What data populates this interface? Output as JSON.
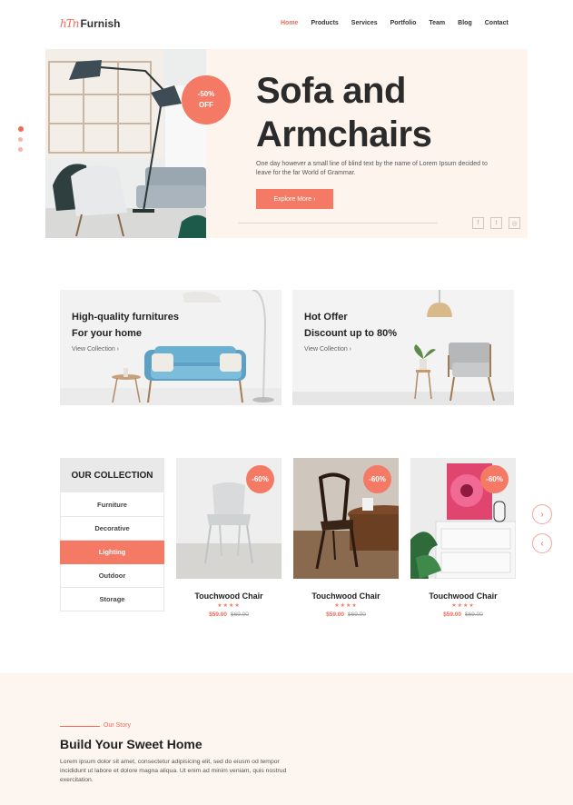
{
  "header": {
    "logo_mark": "hTn",
    "logo_name": "Furnish",
    "nav": [
      "Home",
      "Products",
      "Services",
      "Portfolio",
      "Team",
      "Blog",
      "Contact"
    ],
    "active_nav": "Home"
  },
  "hero": {
    "badge": "-50%\nOFF",
    "title_line1": "Sofa and",
    "title_line2": "Armchairs",
    "description": "One day however a small line of blind text by the name of Lorem Ipsum decided to leave for the far World of Grammar.",
    "cta": "Explore More  ›",
    "socials": [
      "f",
      "t",
      "◎"
    ]
  },
  "promos": [
    {
      "line1": "High-quality furnitures",
      "line2": "For your home",
      "link": "View Collection  ›"
    },
    {
      "line1": "Hot Offer",
      "line2": "Discount up to 80%",
      "link": "View Collection  ›"
    }
  ],
  "collection": {
    "heading": "OUR COLLECTION",
    "items": [
      "Furniture",
      "Decorative",
      "Lighting",
      "Outdoor",
      "Storage"
    ],
    "active": "Lighting"
  },
  "products": [
    {
      "badge": "-60%",
      "name": "Touchwood Chair",
      "stars": "★★★★",
      "price": "$59.00",
      "old_price": "$69.00"
    },
    {
      "badge": "-60%",
      "name": "Touchwood Chair",
      "stars": "★★★★",
      "price": "$59.00",
      "old_price": "$69.00"
    },
    {
      "badge": "-60%",
      "name": "Touchwood Chair",
      "stars": "★★★★",
      "price": "$59.00",
      "old_price": "$69.00"
    }
  ],
  "carousel": {
    "next": "›",
    "prev": "‹"
  },
  "story": {
    "kicker": "Our Story",
    "title": "Build Your Sweet Home",
    "body": "Lorem ipsum dolor sit amet, consectetur adipisicing elit, sed do eiusm od tempor incididunt ut labore et dolore magna aliqua. Ut enim ad minim veniam, quis nostrud exercitation."
  },
  "colors": {
    "accent": "#f57a65",
    "hero_bg": "#fdf4ee"
  }
}
